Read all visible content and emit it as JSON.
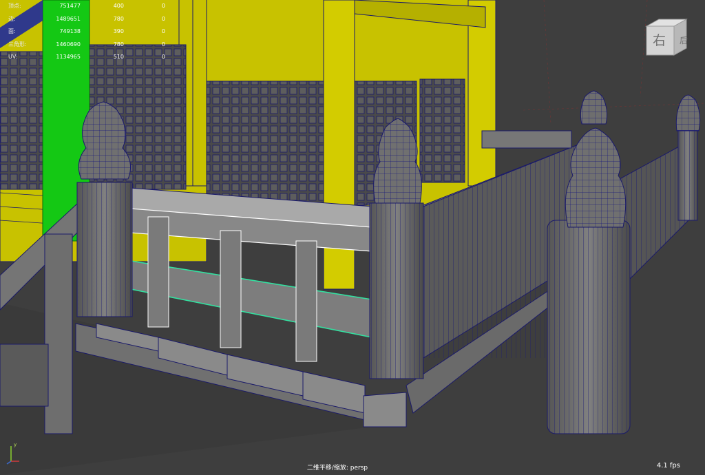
{
  "hud": {
    "rows": [
      {
        "label": "顶点:",
        "total": "751477",
        "selected": "400",
        "extra": "0"
      },
      {
        "label": "边:",
        "total": "1489651",
        "selected": "780",
        "extra": "0"
      },
      {
        "label": "面:",
        "total": "749138",
        "selected": "390",
        "extra": "0"
      },
      {
        "label": "三角形:",
        "total": "1460690",
        "selected": "780",
        "extra": "0"
      },
      {
        "label": "UV:",
        "total": "1134965",
        "selected": "510",
        "extra": "0"
      }
    ]
  },
  "view_cube": {
    "front_label": "右",
    "side_label": "后"
  },
  "camera_label": "二维平移/缩放: persp",
  "fps": "4.1 fps",
  "axis": {
    "y_label": "y"
  },
  "colors": {
    "background": "#3d3d3d",
    "wireframe": "#1a1a7a",
    "yellow_wall": "#c8c200",
    "green_selection": "#14c814",
    "selected_edge": "#33e0a0",
    "grey_mesh": "#6b6b6b"
  }
}
